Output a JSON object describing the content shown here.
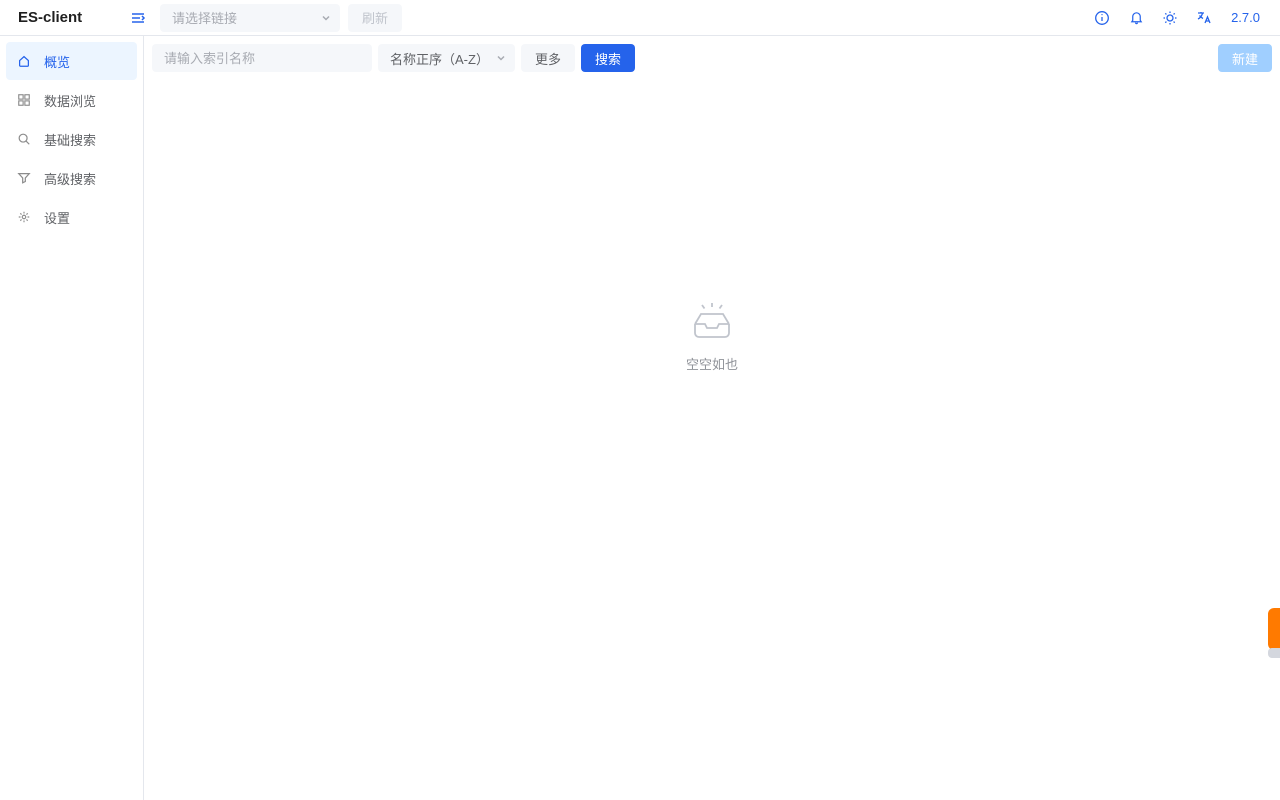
{
  "header": {
    "brand": "ES-client",
    "conn_placeholder": "请选择链接",
    "refresh_label": "刷新",
    "version": "2.7.0"
  },
  "sidebar": {
    "items": [
      {
        "label": "概览"
      },
      {
        "label": "数据浏览"
      },
      {
        "label": "基础搜索"
      },
      {
        "label": "高级搜索"
      },
      {
        "label": "设置"
      }
    ]
  },
  "toolbar": {
    "search_placeholder": "请输入索引名称",
    "sort_label": "名称正序（A-Z）",
    "more_label": "更多",
    "search_label": "搜索",
    "create_label": "新建"
  },
  "empty": {
    "text": "空空如也"
  }
}
